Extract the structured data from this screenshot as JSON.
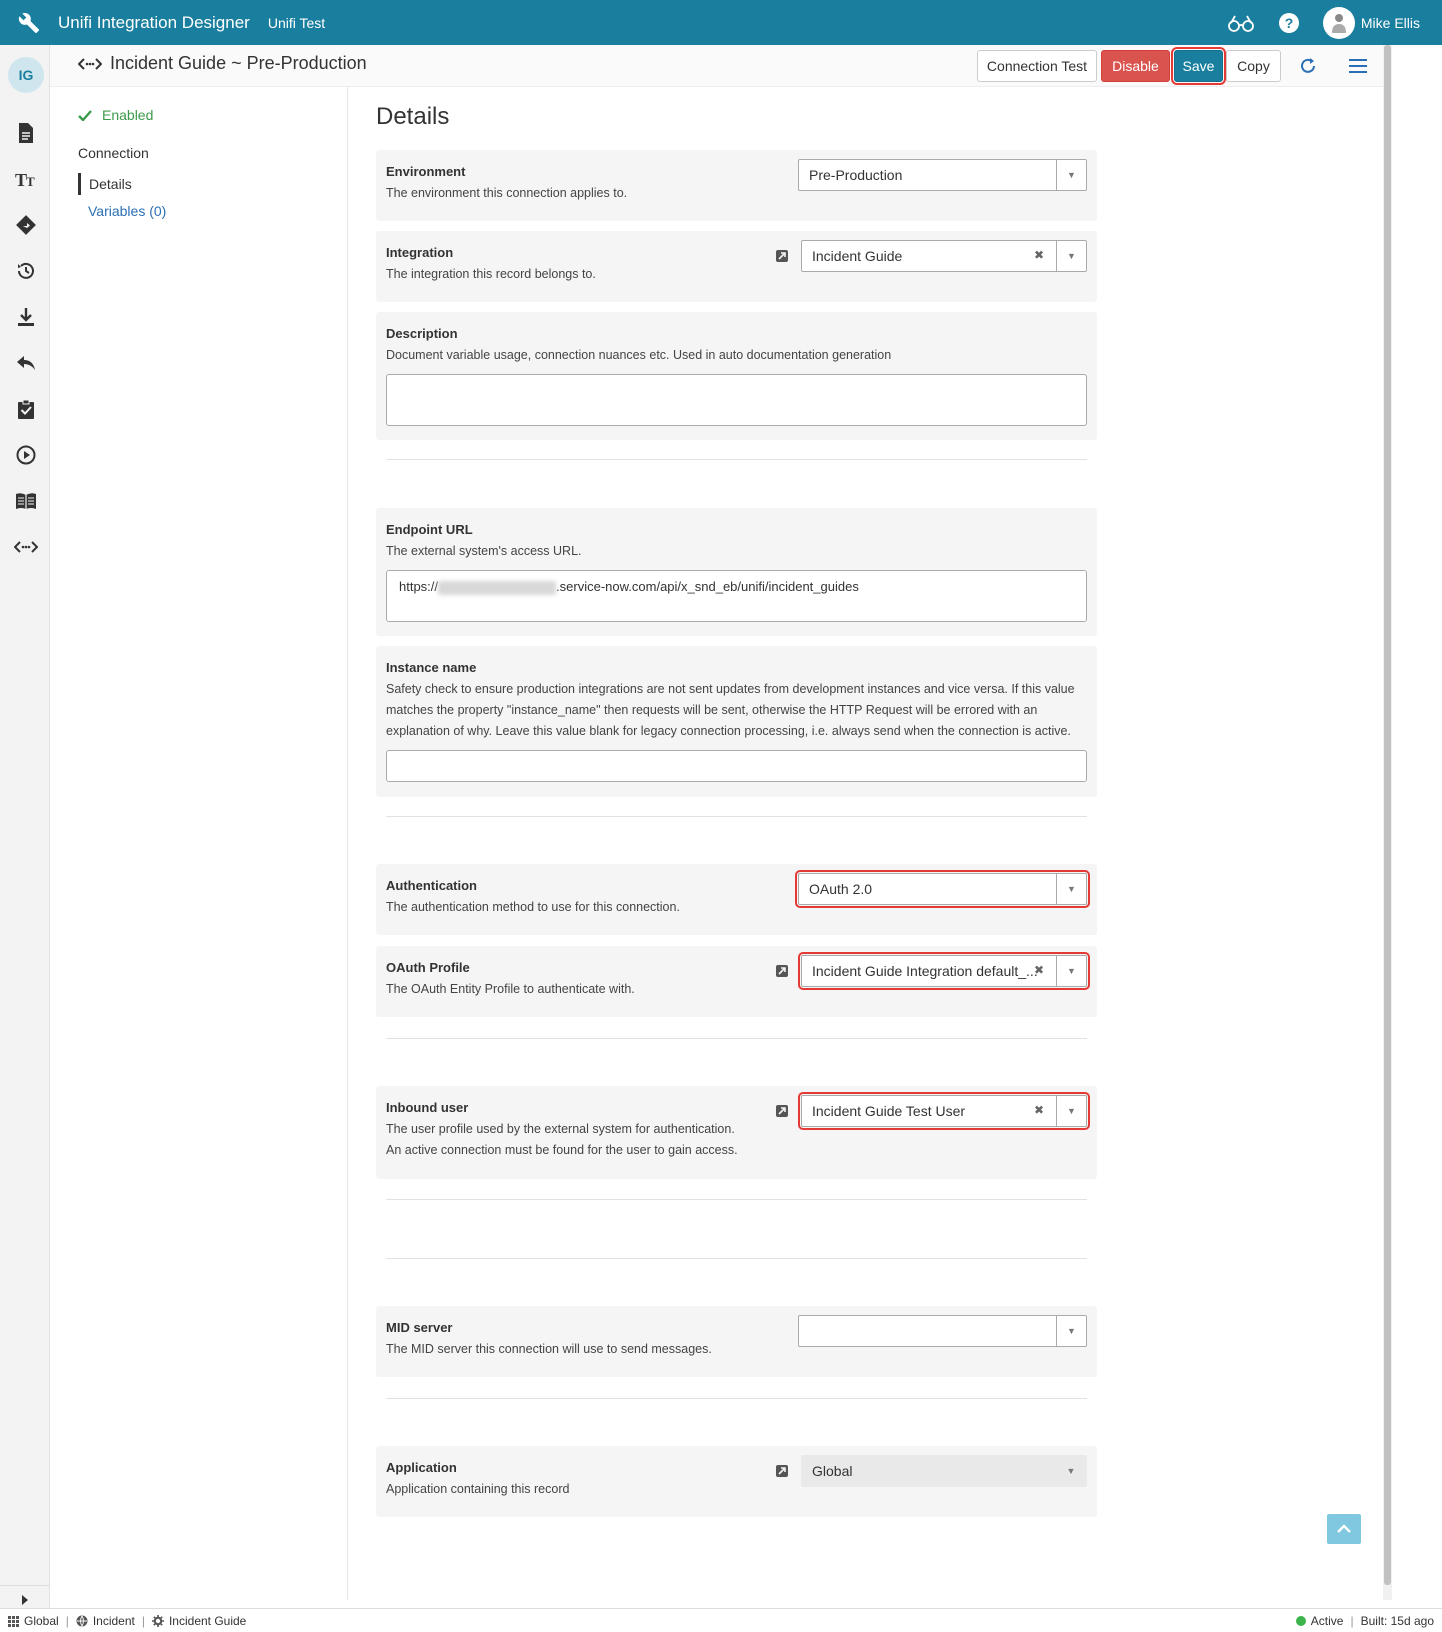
{
  "topbar": {
    "app_title": "Unifi Integration Designer",
    "app_sub": "Unifi Test",
    "user_name": "Mike Ellis",
    "icons": [
      "wrench-icon",
      "glasses-icon",
      "help-icon",
      "user-avatar"
    ]
  },
  "rail": {
    "badge": "IG",
    "icons": [
      "document-icon",
      "text-format-icon",
      "route-icon",
      "history-icon",
      "download-icon",
      "reply-icon",
      "clipboard-check-icon",
      "play-circle-icon",
      "book-icon",
      "code-connection-icon"
    ]
  },
  "subheader": {
    "title": "Incident Guide ~ Pre-Production",
    "buttons": {
      "connection_test": "Connection Test",
      "disable": "Disable",
      "save": "Save",
      "copy": "Copy"
    }
  },
  "nav": {
    "status": "Enabled",
    "section": "Connection",
    "details": "Details",
    "variables": "Variables (0)"
  },
  "main": {
    "heading": "Details",
    "environment": {
      "label": "Environment",
      "desc": "The environment this connection applies to.",
      "value": "Pre-Production"
    },
    "integration": {
      "label": "Integration",
      "desc": "The integration this record belongs to.",
      "value": "Incident Guide"
    },
    "description": {
      "label": "Description",
      "desc": "Document variable usage, connection nuances etc. Used in auto documentation generation",
      "value": ""
    },
    "endpoint": {
      "label": "Endpoint URL",
      "desc": "The external system's access URL.",
      "prefix": "https://",
      "suffix": ".service-now.com/api/x_snd_eb/unifi/incident_guides"
    },
    "instance": {
      "label": "Instance name",
      "desc_1": "Safety check to ensure production integrations are not sent updates from development instances and vice versa. If this value",
      "desc_2": "matches the property \"instance_name\" then requests will be sent, otherwise the HTTP Request will be errored with an",
      "desc_3": "explanation of why. Leave this value blank for legacy connection processing, i.e. always send when the connection is active.",
      "value": ""
    },
    "authentication": {
      "label": "Authentication",
      "desc": "The authentication method to use for this connection.",
      "value": "OAuth 2.0"
    },
    "oauth_profile": {
      "label": "OAuth Profile",
      "desc": "The OAuth Entity Profile to authenticate with.",
      "value": "Incident Guide Integration default_..."
    },
    "inbound_user": {
      "label": "Inbound user",
      "desc_1": "The user profile used by the external system for authentication.",
      "desc_2": "An active connection must be found for the user to gain access.",
      "value": "Incident Guide Test User"
    },
    "mid_server": {
      "label": "MID server",
      "desc": "The MID server this connection will use to send messages.",
      "value": ""
    },
    "application": {
      "label": "Application",
      "desc": "Application containing this record",
      "value": "Global"
    }
  },
  "statusbar": {
    "scope": "Global",
    "table": "Incident",
    "integration": "Incident Guide",
    "state": "Active",
    "built": "Built: 15d ago"
  },
  "colors": {
    "brand": "#1a7f9e",
    "danger": "#d9534f",
    "highlight": "#e53935",
    "success": "#3c9a4a"
  }
}
